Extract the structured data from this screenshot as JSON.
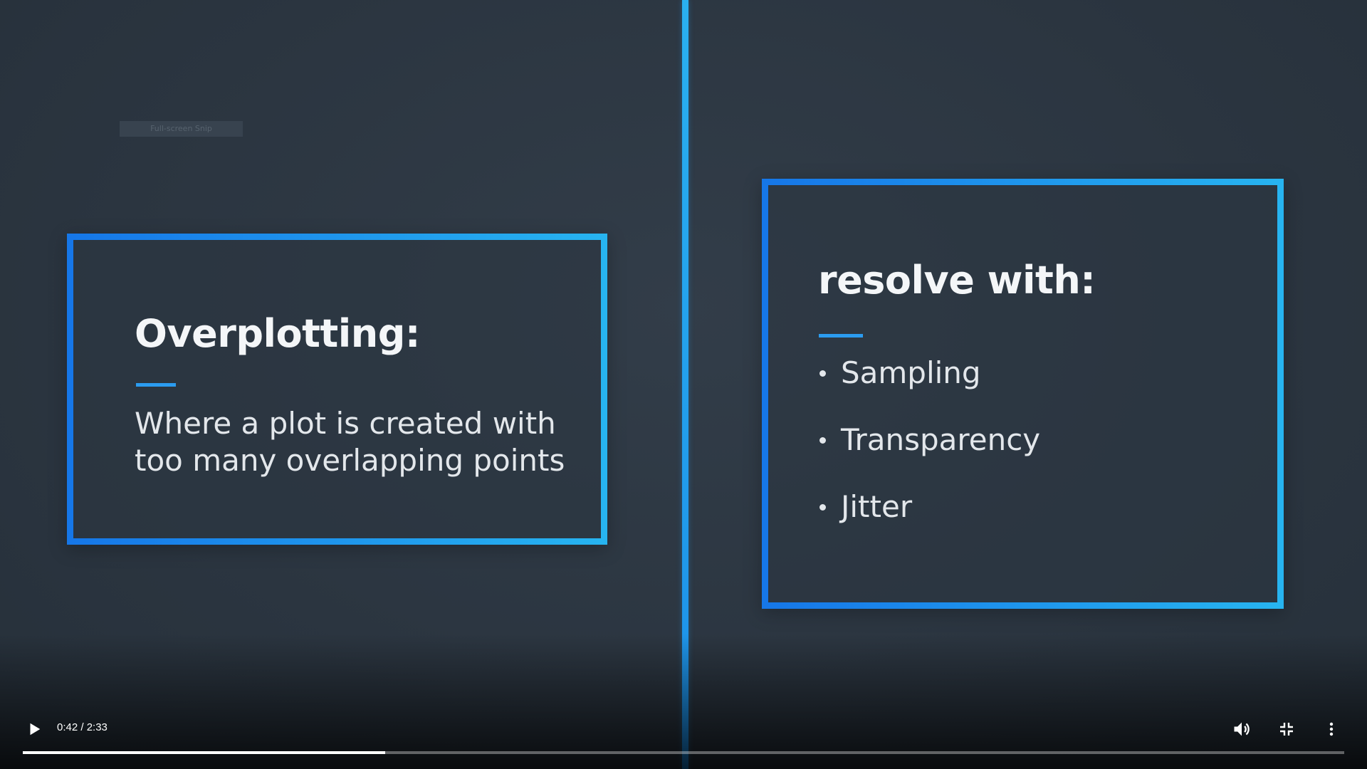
{
  "overlay": {
    "snip_label": "Full-screen Snip"
  },
  "left_card": {
    "heading": "Overplotting:",
    "body_lines": [
      "Where a plot is created with",
      "too many overlapping points"
    ]
  },
  "right_card": {
    "heading": "resolve with:",
    "bullets": [
      "Sampling",
      "Transparency",
      "Jitter"
    ]
  },
  "player": {
    "time_display": "0:42 / 2:33",
    "progress_fraction": 0.2745,
    "icons": {
      "play": "play-icon",
      "volume": "volume-icon",
      "exit_fullscreen": "exit-fullscreen-icon",
      "more": "more-vert-icon"
    }
  },
  "colors": {
    "background": "#2d3742",
    "accent_blue": "#1e90ea",
    "text": "#f4f6f8"
  }
}
